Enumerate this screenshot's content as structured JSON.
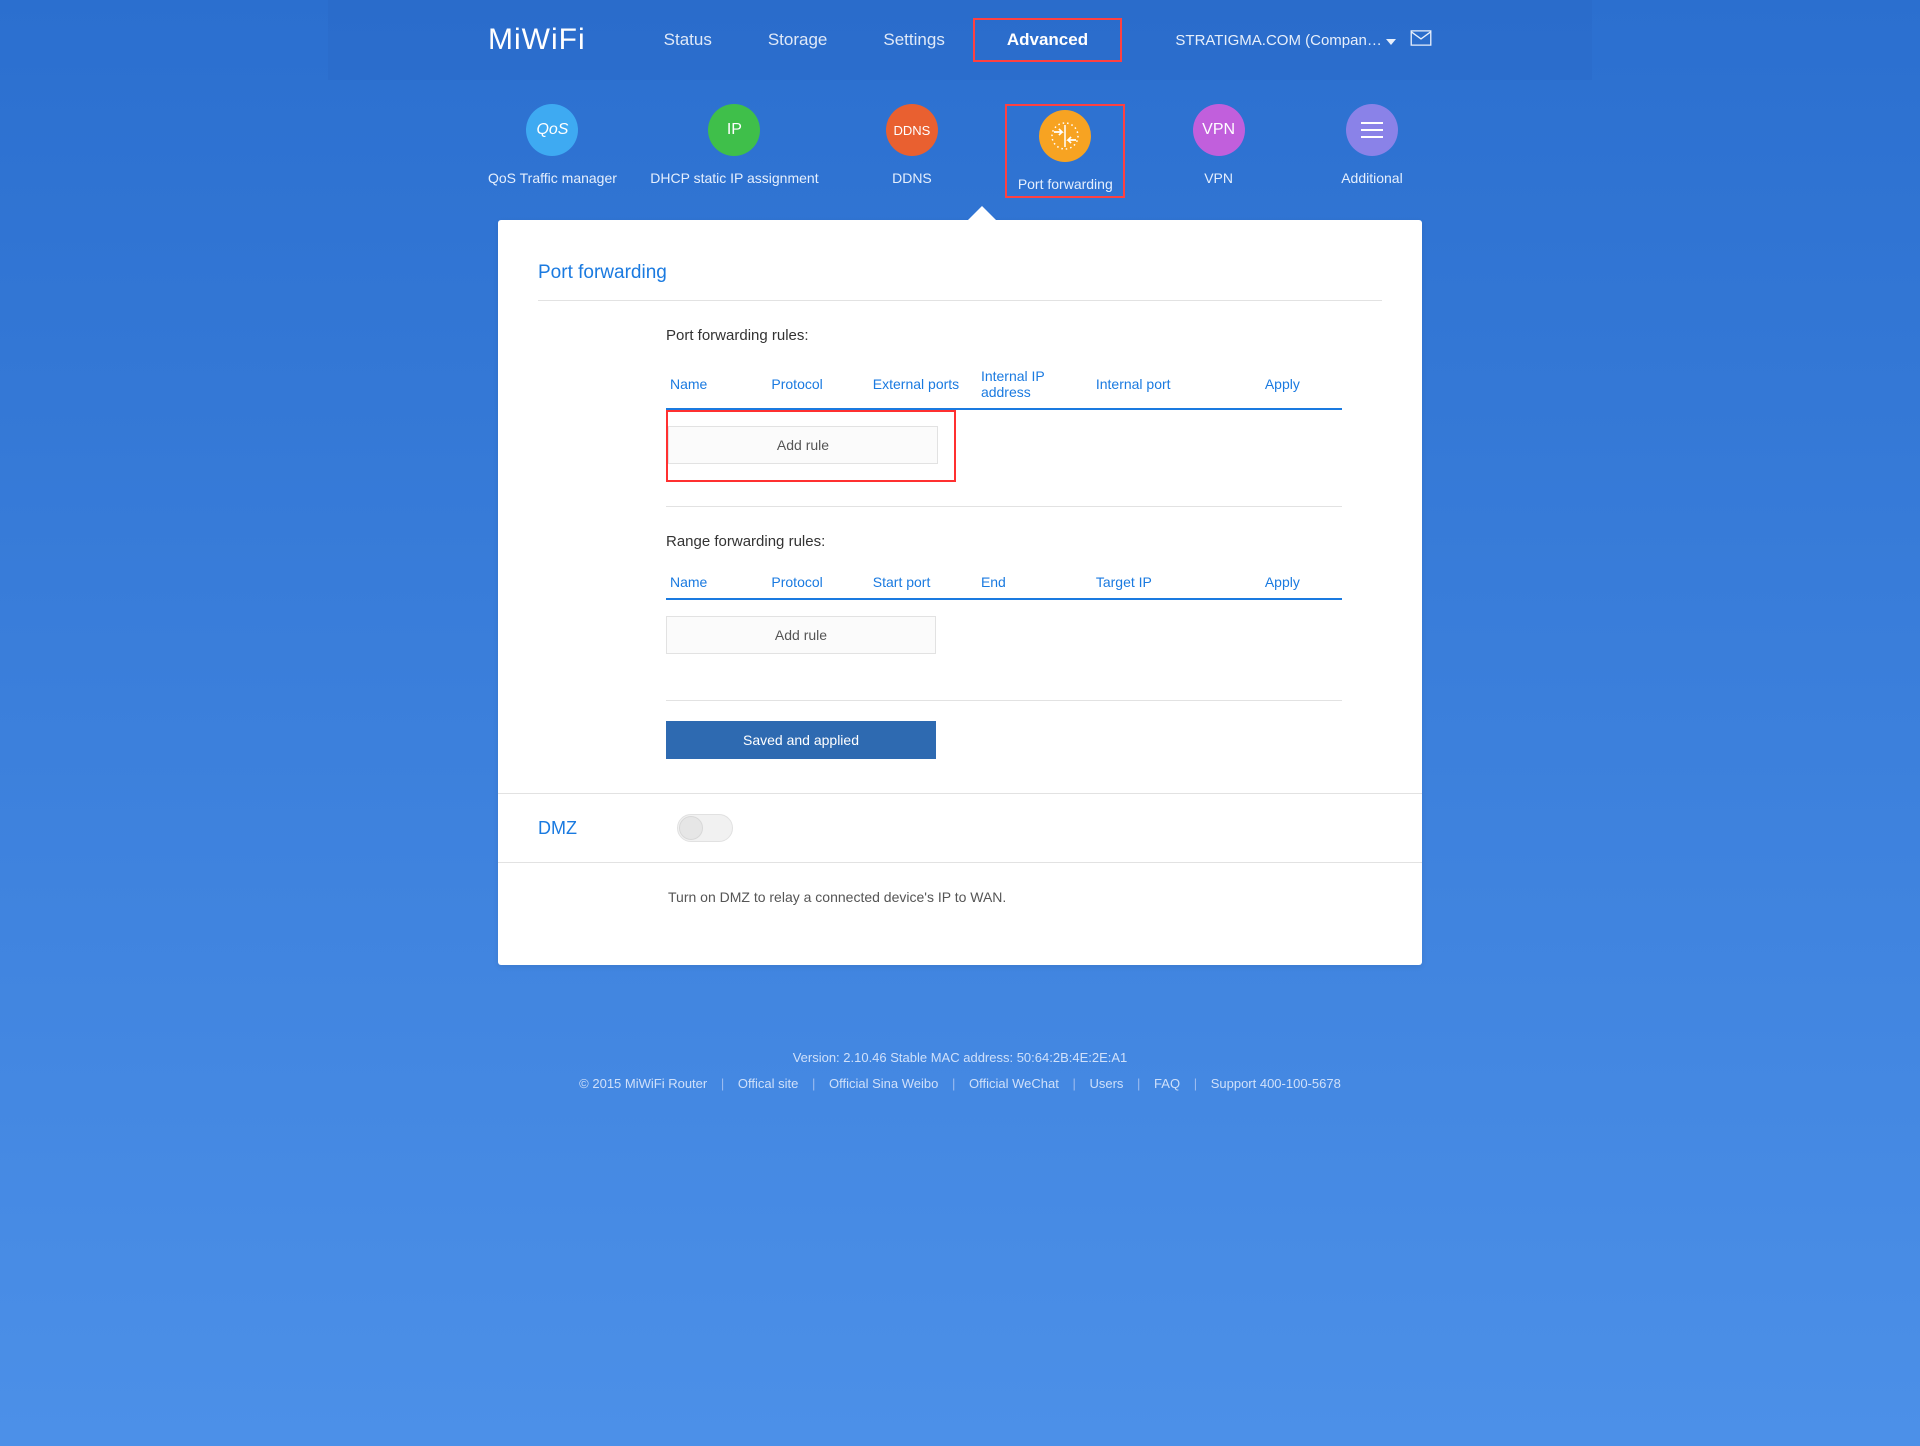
{
  "logo": "MiWiFi",
  "nav": {
    "status": "Status",
    "storage": "Storage",
    "settings": "Settings",
    "advanced": "Advanced"
  },
  "account": {
    "name": "STRATIGMA.COM (Compan…"
  },
  "subnav": {
    "qos_icon_text": "QoS",
    "qos_label": "QoS Traffic manager",
    "ip_icon_text": "IP",
    "ip_label": "DHCP static IP assignment",
    "ddns_icon_text": "DDNS",
    "ddns_label": "DDNS",
    "portfwd_label": "Port forwarding",
    "vpn_icon_text": "VPN",
    "vpn_label": "VPN",
    "additional_label": "Additional"
  },
  "portfwd": {
    "title": "Port forwarding",
    "rules_heading": "Port forwarding rules:",
    "cols": {
      "name": "Name",
      "protocol": "Protocol",
      "external_ports": "External ports",
      "internal_ip": "Internal IP address",
      "internal_port": "Internal port",
      "apply": "Apply"
    },
    "add_rule": "Add rule",
    "range_heading": "Range forwarding rules:",
    "range_cols": {
      "name": "Name",
      "protocol": "Protocol",
      "start_port": "Start port",
      "end": "End",
      "target_ip": "Target IP",
      "apply": "Apply"
    },
    "range_add_rule": "Add rule",
    "save_applied": "Saved and applied"
  },
  "dmz": {
    "label": "DMZ",
    "desc": "Turn on DMZ to relay a connected device's IP to WAN."
  },
  "footer": {
    "version_line": "Version: 2.10.46 Stable  MAC address: 50:64:2B:4E:2E:A1",
    "copyright": "© 2015 MiWiFi Router",
    "official_site": "Offical site",
    "weibo": "Official Sina Weibo",
    "wechat": "Official WeChat",
    "users": "Users",
    "faq": "FAQ",
    "support": "Support 400-100-5678"
  }
}
